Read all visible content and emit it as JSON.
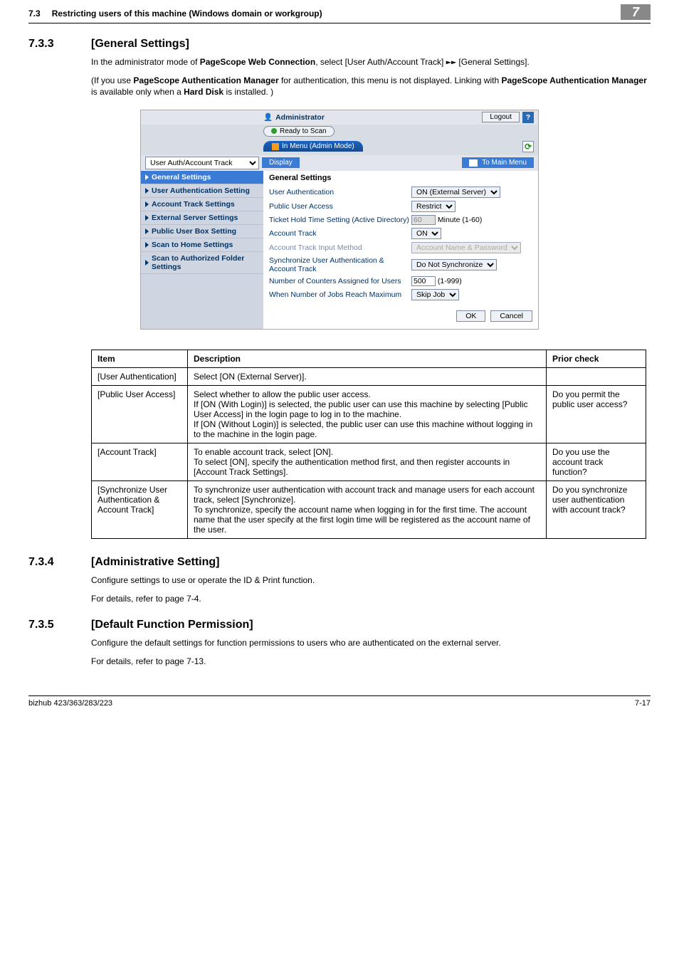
{
  "header": {
    "section_number": "7.3",
    "section_title": "Restricting users of this machine (Windows domain or workgroup)",
    "badge": "7"
  },
  "h733": {
    "num": "7.3.3",
    "title": "[General Settings]"
  },
  "p733a_prefix": "In the administrator mode of ",
  "p733a_bold": "PageScope Web Connection",
  "p733a_mid": ", select [User Auth/Account Track] ",
  "p733a_arrows": "►►",
  "p733a_suffix": " [General Settings].",
  "p733b_prefix": "(If you use ",
  "p733b_bold1": "PageScope Authentication Manager",
  "p733b_mid1": " for authentication, this menu is not displayed. Linking with ",
  "p733b_bold2": "PageScope Authentication Manager",
  "p733b_mid2": " is available only when a ",
  "p733b_bold3": "Hard Disk",
  "p733b_suffix": " is installed. )",
  "embed": {
    "admin": "Administrator",
    "logout": "Logout",
    "help": "?",
    "ready": "Ready to Scan",
    "tab": "In Menu (Admin Mode)",
    "refresh": "⟳",
    "crumb_select": "User Auth/Account Track",
    "display_btn": "Display",
    "to_main": "To Main Menu",
    "sidebar": [
      "General Settings",
      "User Authentication Setting",
      "Account Track Settings",
      "External Server Settings",
      "Public User Box Setting",
      "Scan to Home Settings",
      "Scan to Authorized Folder Settings"
    ],
    "panel_title": "General Settings",
    "rows": [
      {
        "label": "User Authentication",
        "ctrl_type": "select",
        "value": "ON (External Server)"
      },
      {
        "label": "Public User Access",
        "ctrl_type": "select",
        "value": "Restrict"
      },
      {
        "label": "Ticket Hold Time Setting (Active Directory)",
        "ctrl_type": "number_unit",
        "value": "60",
        "unit": "Minute (1-60)"
      },
      {
        "label": "Account Track",
        "ctrl_type": "select",
        "value": "ON"
      },
      {
        "label": "Account Track Input Method",
        "ctrl_type": "select_disabled",
        "value": "Account Name & Password"
      },
      {
        "label": "Synchronize User Authentication & Account Track",
        "ctrl_type": "select",
        "value": "Do Not Synchronize"
      },
      {
        "label": "Number of Counters Assigned for Users",
        "ctrl_type": "number_unit",
        "value": "500",
        "unit": "(1-999)"
      },
      {
        "label": "When Number of Jobs Reach Maximum",
        "ctrl_type": "select",
        "value": "Skip Job"
      }
    ],
    "ok": "OK",
    "cancel": "Cancel"
  },
  "table": {
    "headers": {
      "c1": "Item",
      "c2": "Description",
      "c3": "Prior check"
    },
    "rows": [
      {
        "c1": "[User Authentication]",
        "c2": "Select [ON (External Server)].",
        "c3": ""
      },
      {
        "c1": "[Public User Access]",
        "c2": "Select whether to allow the public user access.\nIf [ON (With Login)] is selected, the public user can use this machine by selecting [Public User Access] in the login page to log in to the machine.\nIf [ON (Without Login)] is selected, the public user can use this machine without logging in to the machine in the login page.",
        "c3": "Do you permit the public user access?"
      },
      {
        "c1": "[Account Track]",
        "c2": "To enable account track, select [ON].\nTo select [ON], specify the authentication method first, and then register accounts in [Account Track Settings].",
        "c3": "Do you use the account track function?"
      },
      {
        "c1": "[Synchronize User Authentication & Account Track]",
        "c2": "To synchronize user authentication with account track and manage users for each account track, select [Synchronize].\nTo synchronize, specify the account name when logging in for the first time. The account name that the user specify at the first login time will be registered as the account name of the user.",
        "c3": "Do you synchronize user authentication with account track?"
      }
    ]
  },
  "h734": {
    "num": "7.3.4",
    "title": "[Administrative Setting]"
  },
  "p734a": "Configure settings to use or operate the ID & Print function.",
  "p734b": "For details, refer to page 7-4.",
  "h735": {
    "num": "7.3.5",
    "title": "[Default Function Permission]"
  },
  "p735a": "Configure the default settings for function permissions to users who are authenticated on the external server.",
  "p735b": "For details, refer to page 7-13.",
  "footer": {
    "left": "bizhub 423/363/283/223",
    "right": "7-17"
  }
}
